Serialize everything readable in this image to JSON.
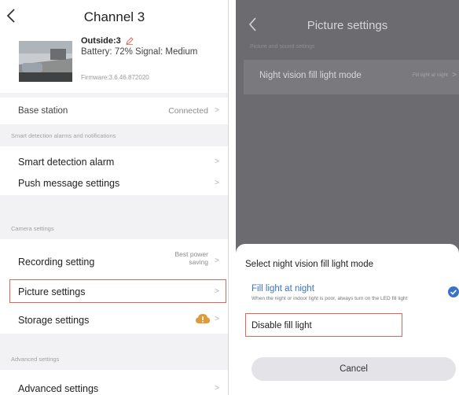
{
  "left": {
    "header": {
      "title": "Channel 3"
    },
    "device": {
      "name": "Outside:3",
      "battery_signal": "Battery: 72% Signal: Medium",
      "firmware": "Firmware:3.6.46.872020"
    },
    "base_station": {
      "label": "Base station",
      "value": "Connected"
    },
    "sections": {
      "smart": "Smart detection alarms and notifications",
      "camera": "Camera settings",
      "advanced": "Advanced settings"
    },
    "items": {
      "smart_detection_alarm": "Smart detection alarm",
      "push_message_settings": "Push message settings",
      "recording_setting": "Recording setting",
      "recording_value": "Best power saving",
      "picture_settings": "Picture settings",
      "storage_settings": "Storage settings",
      "advanced_settings": "Advanced settings"
    },
    "chevron": ">"
  },
  "right": {
    "header": {
      "title": "Picture settings"
    },
    "subtitle": "Picture and sound settings",
    "row": {
      "label": "Night vision fill light mode",
      "value": "Fill light at night",
      "chevron": ">"
    },
    "sheet": {
      "title": "Select night vision fill light mode",
      "option1": {
        "label": "Fill light at night",
        "desc": "When the night or indoor light is poor, always turn on the LED fill light"
      },
      "option2": {
        "label": "Disable fill light"
      },
      "cancel": "Cancel"
    }
  },
  "colors": {
    "accent": "#3a72c9",
    "highlight": "#e0665c",
    "overlay": "#6c6c70",
    "warning_icon": "#e09a3a"
  },
  "icons": [
    "back-icon",
    "edit-icon",
    "chevron-right-icon",
    "cloud-warning-icon",
    "checkmark-icon"
  ]
}
